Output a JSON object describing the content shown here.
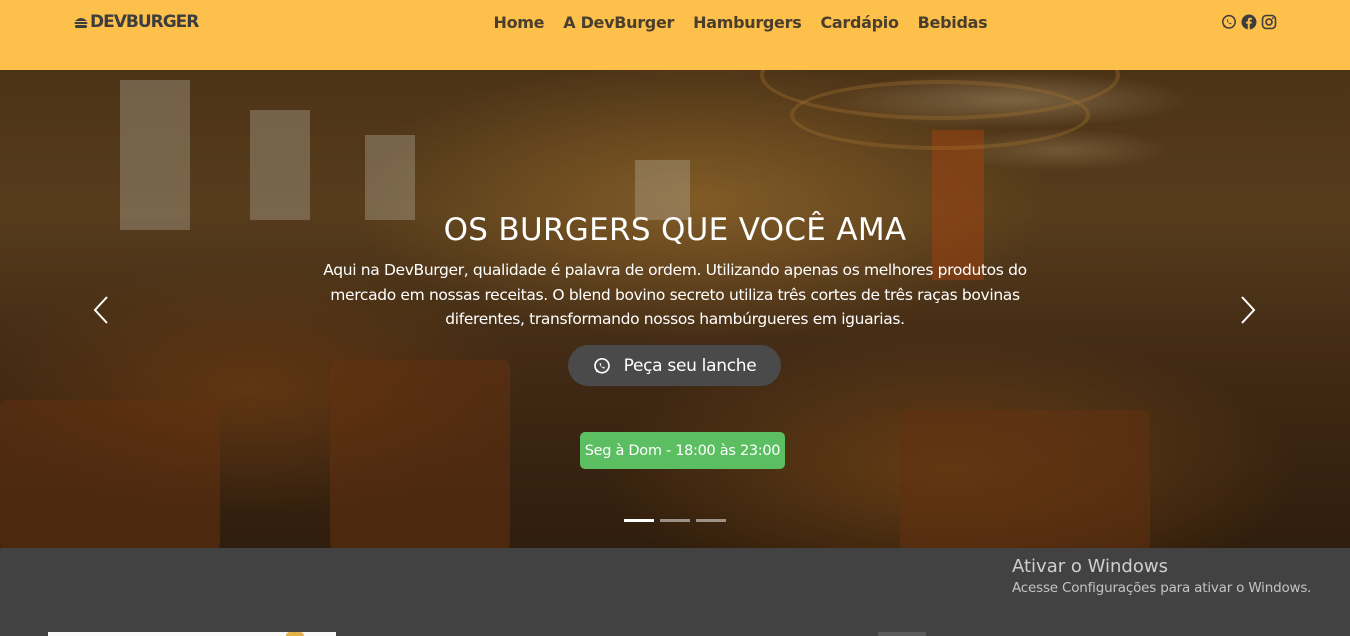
{
  "header": {
    "logo_text": "DEVBURGER",
    "nav": [
      {
        "label": "Home"
      },
      {
        "label": "A DevBurger"
      },
      {
        "label": "Hamburgers"
      },
      {
        "label": "Cardápio"
      },
      {
        "label": "Bebidas"
      }
    ],
    "socials": [
      "whatsapp-icon",
      "facebook-icon",
      "instagram-icon"
    ]
  },
  "hero": {
    "title": "OS BURGERS QUE VOCÊ AMA",
    "text_line1": "Aqui na DevBurger, qualidade é palavra de ordem. Utilizando apenas os melhores produtos do",
    "text_line2": "mercado em nossas receitas. O blend bovino secreto utiliza três cortes de três raças bovinas",
    "text_line3": "diferentes, transformando nossos hambúrgueres em iguarias.",
    "cta_label": "Peça seu lanche",
    "hours": "Seg à Dom - 18:00 às 23:00",
    "slides_total": 3,
    "active_slide": 1
  },
  "windows_watermark": {
    "title": "Ativar o Windows",
    "subtitle": "Acesse Configurações para ativar o Windows."
  },
  "colors": {
    "header_bg": "#fdc04a",
    "hours_badge": "#5bbf62",
    "cta_bg": "#4a4a4a",
    "below_bg": "#424242"
  }
}
